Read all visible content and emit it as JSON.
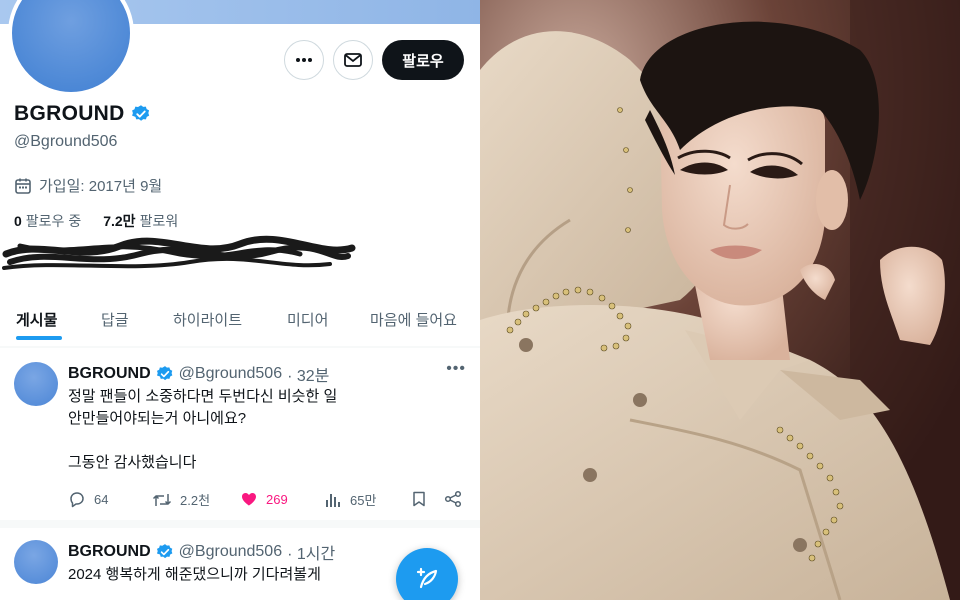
{
  "profile": {
    "display_name": "BGROUND",
    "handle": "@Bground506",
    "joined": "가입일: 2017년 9월",
    "following_count": "0",
    "following_label": "팔로우 중",
    "followers_count": "7.2만",
    "followers_label": "팔로워",
    "follow_button": "팔로우"
  },
  "tabs": [
    "게시물",
    "답글",
    "하이라이트",
    "미디어",
    "마음에 들어요"
  ],
  "tweets": [
    {
      "name": "BGROUND",
      "handle": "@Bground506",
      "time": "· 32분",
      "lines": [
        "정말 팬들이 소중하다면 두번다신 비슷한 일",
        "안만들어야되는거 아니에요?",
        "그동안 감사했습니다"
      ],
      "replies": "64",
      "retweets": "2.2천",
      "likes": "269",
      "views": "65만"
    },
    {
      "name": "BGROUND",
      "handle": "@Bground506",
      "time": "· 1시간",
      "lines": [
        "2024 행복하게 해준댔으니까 기다려볼게"
      ]
    }
  ],
  "icons": {
    "more": "more-horizontal-icon",
    "message": "envelope-icon",
    "verified": "verified-badge-icon",
    "calendar": "calendar-icon",
    "reply": "reply-icon",
    "retweet": "retweet-icon",
    "like": "heart-icon",
    "views": "views-icon",
    "bookmark": "bookmark-icon",
    "share": "share-icon",
    "compose": "compose-icon"
  },
  "colors": {
    "accent": "#1d9bf0",
    "like": "#f91880",
    "text": "#0f1419",
    "muted": "#536471"
  }
}
